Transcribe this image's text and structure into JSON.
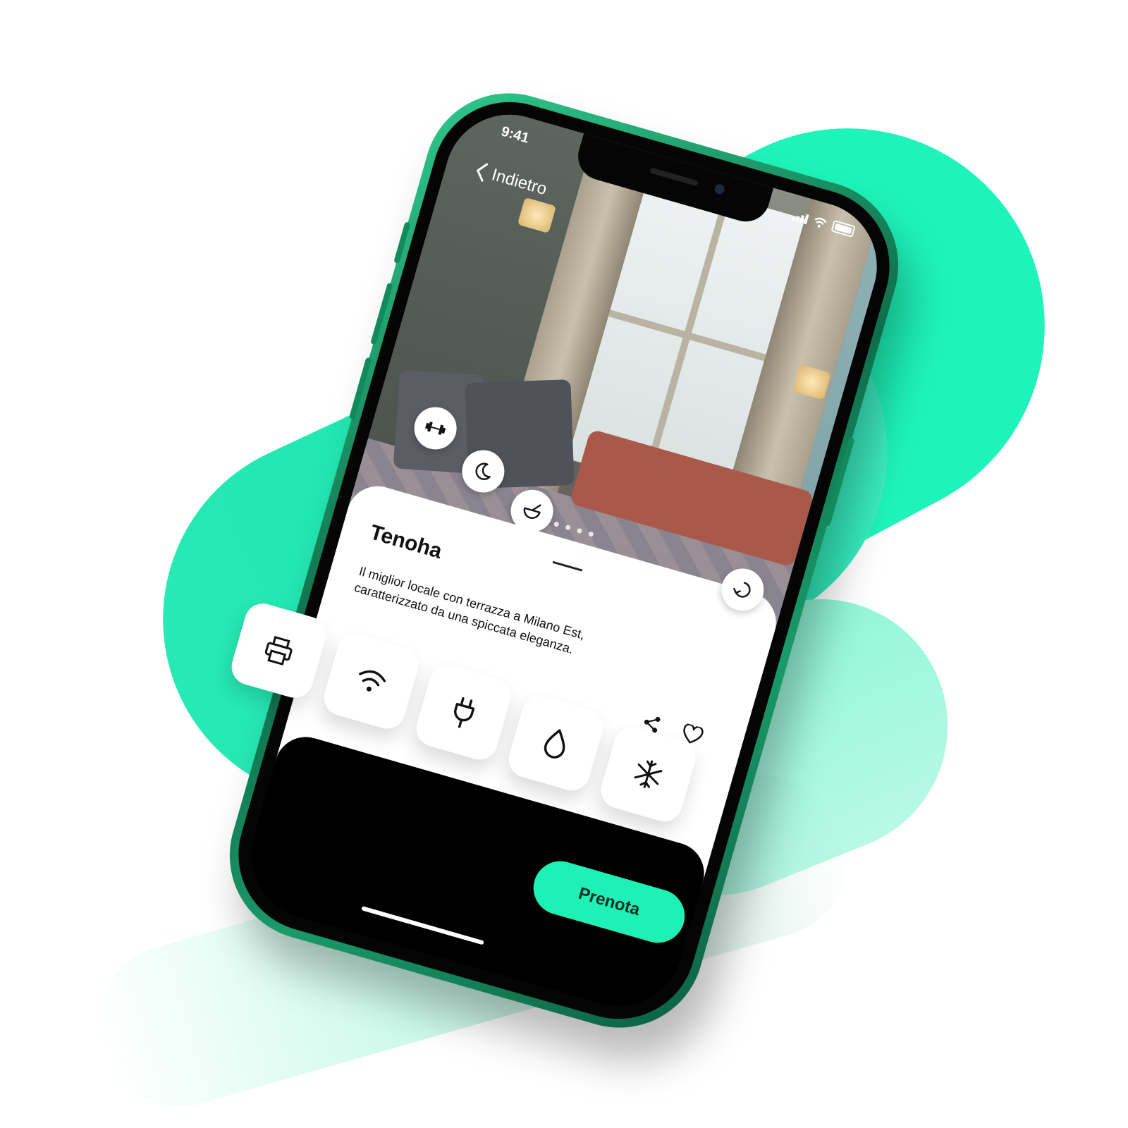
{
  "status_bar": {
    "time": "9:41"
  },
  "nav": {
    "back_label": "Indietro"
  },
  "place": {
    "name": "Tenoha",
    "description": "Il miglior locale con terrazza a Milano Est, caratterizzato da una spiccata eleganza."
  },
  "gallery": {
    "pages": 5,
    "current": 1
  },
  "photo_feature_icons": [
    "dumbbell-icon",
    "moon-icon",
    "bowl-icon"
  ],
  "view_360_icon": "rotate-360-icon",
  "actions": {
    "share_icon": "share-icon",
    "favorite_icon": "heart-icon"
  },
  "amenities": [
    "printer-icon",
    "wifi-icon",
    "plug-icon",
    "water-drop-icon",
    "snowflake-icon"
  ],
  "cta": {
    "label": "Prenota"
  },
  "colors": {
    "accent": "#1ef0b6",
    "phone_green": "#128a5e",
    "text": "#111111"
  }
}
